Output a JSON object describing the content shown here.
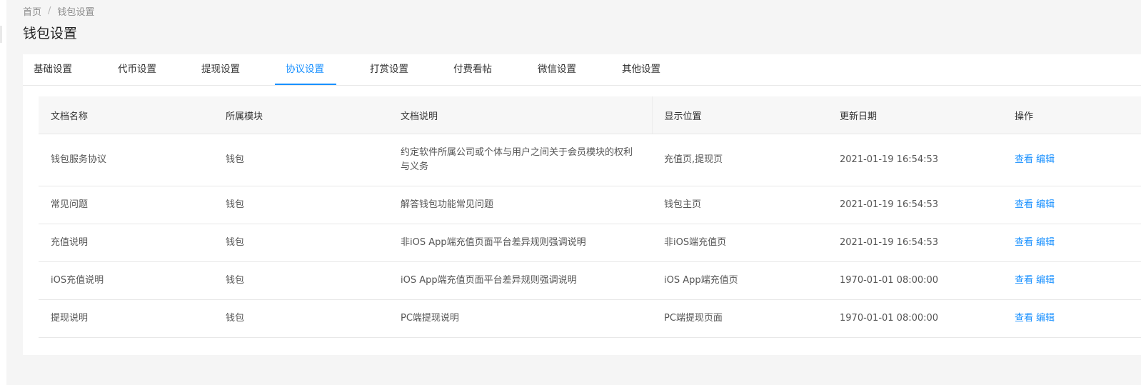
{
  "breadcrumb": {
    "home": "首页",
    "separator": "/",
    "current": "钱包设置"
  },
  "page_title": "钱包设置",
  "tabs": [
    {
      "label": "基础设置",
      "active": false
    },
    {
      "label": "代币设置",
      "active": false
    },
    {
      "label": "提现设置",
      "active": false
    },
    {
      "label": "协议设置",
      "active": true
    },
    {
      "label": "打赏设置",
      "active": false
    },
    {
      "label": "付费看帖",
      "active": false
    },
    {
      "label": "微信设置",
      "active": false
    },
    {
      "label": "其他设置",
      "active": false
    }
  ],
  "table": {
    "headers": [
      "文档名称",
      "所属模块",
      "文档说明",
      "显示位置",
      "更新日期",
      "操作"
    ],
    "rows": [
      {
        "name": "钱包服务协议",
        "module": "钱包",
        "description": "约定软件所属公司或个体与用户之间关于会员模块的权利与义务",
        "position": "充值页,提现页",
        "updated": "2021-01-19 16:54:53",
        "view": "查看",
        "edit": "编辑"
      },
      {
        "name": "常见问题",
        "module": "钱包",
        "description": "解答钱包功能常见问题",
        "position": "钱包主页",
        "updated": "2021-01-19 16:54:53",
        "view": "查看",
        "edit": "编辑"
      },
      {
        "name": "充值说明",
        "module": "钱包",
        "description": "非iOS App端充值页面平台差异规则强调说明",
        "position": "非iOS端充值页",
        "updated": "2021-01-19 16:54:53",
        "view": "查看",
        "edit": "编辑"
      },
      {
        "name": "iOS充值说明",
        "module": "钱包",
        "description": "iOS App端充值页面平台差异规则强调说明",
        "position": "iOS App端充值页",
        "updated": "1970-01-01 08:00:00",
        "view": "查看",
        "edit": "编辑"
      },
      {
        "name": "提现说明",
        "module": "钱包",
        "description": "PC端提现说明",
        "position": "PC端提现页面",
        "updated": "1970-01-01 08:00:00",
        "view": "查看",
        "edit": "编辑"
      }
    ]
  },
  "colors": {
    "accent": "#1890ff",
    "page_background": "#f5f5f5",
    "header_background": "#f7f7f7",
    "border": "#e8e8e8"
  }
}
